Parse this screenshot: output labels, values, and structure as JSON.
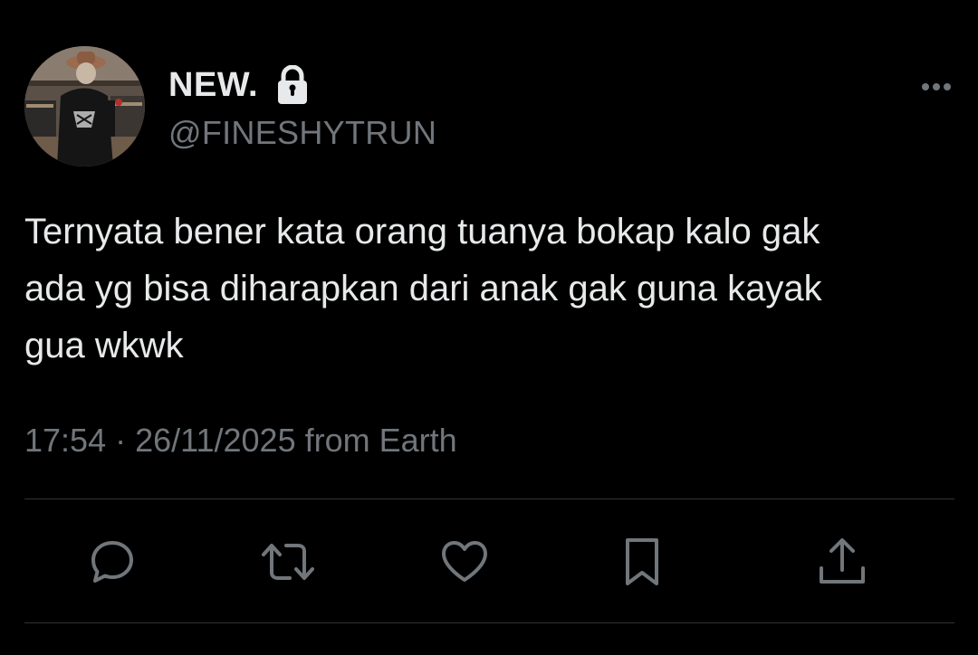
{
  "tweet": {
    "display_name": "NEW.",
    "handle": "@FINESHYTRUN",
    "text": "Ternyata bener kata orang tuanya bokap kalo gak\nada yg bisa diharapkan dari anak gak guna kayak\ngua wkwk",
    "time": "17:54",
    "separator": "·",
    "date": "26/11/2025",
    "source": "from Earth"
  },
  "icons": {
    "verified_lock": "lock-icon",
    "more": "more-icon",
    "reply": "reply-icon",
    "retweet": "retweet-icon",
    "like": "like-icon",
    "bookmark": "bookmark-icon",
    "share": "share-icon"
  },
  "colors": {
    "background": "#000000",
    "text_primary": "#e7e9ea",
    "text_secondary": "#71767b",
    "divider": "#2f3336"
  }
}
